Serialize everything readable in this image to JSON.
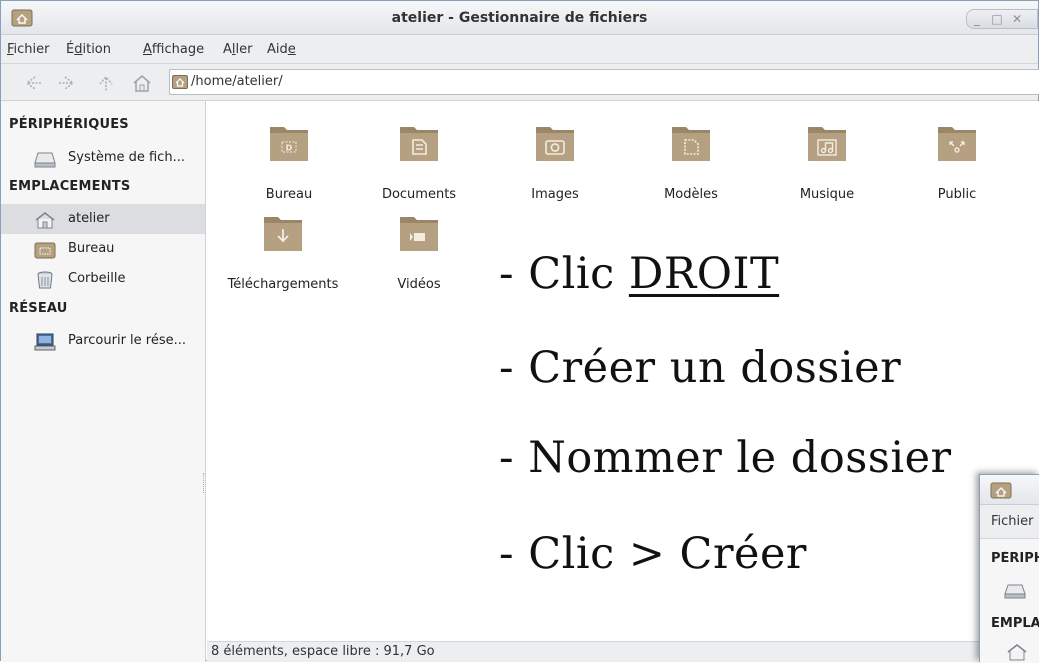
{
  "window": {
    "title": "atelier - Gestionnaire de fichiers",
    "controls": [
      "_",
      "□",
      "✕"
    ]
  },
  "menu": [
    {
      "pre": "",
      "ul": "F",
      "post": "ichier"
    },
    {
      "pre": "É",
      "ul": "d",
      "post": "ition"
    },
    {
      "pre": "",
      "ul": "A",
      "post": "ffichage"
    },
    {
      "pre": "A",
      "ul": "l",
      "post": "ler"
    },
    {
      "pre": "Aid",
      "ul": "e",
      "post": ""
    }
  ],
  "toolbar": {
    "path": "/home/atelier/"
  },
  "sidebar": {
    "sections": {
      "devices": "PÉRIPHÉRIQUES",
      "places": "EMPLACEMENTS",
      "network": "RÉSEAU"
    },
    "devices": [
      {
        "label": "Système de fich...",
        "icon": "drive-icon"
      }
    ],
    "places": [
      {
        "label": "atelier",
        "icon": "home-icon"
      },
      {
        "label": "Bureau",
        "icon": "desktop-folder-icon"
      },
      {
        "label": "Corbeille",
        "icon": "trash-icon"
      }
    ],
    "network": [
      {
        "label": "Parcourir le rése...",
        "icon": "network-icon"
      }
    ]
  },
  "files": [
    {
      "name": "Bureau",
      "emblem": "D"
    },
    {
      "name": "Documents",
      "emblem": "doc"
    },
    {
      "name": "Images",
      "emblem": "camera"
    },
    {
      "name": "Modèles",
      "emblem": "template"
    },
    {
      "name": "Musique",
      "emblem": "music"
    },
    {
      "name": "Public",
      "emblem": "share"
    },
    {
      "name": "Téléchargements",
      "emblem": "download"
    },
    {
      "name": "Vidéos",
      "emblem": "video"
    }
  ],
  "status": "8 éléments, espace libre : 91,7 Go",
  "instructions": {
    "line1_prefix": "- Clic ",
    "line1_underlined": "DROIT",
    "line2": "- Créer un dossier",
    "line3": "- Nommer le dossier",
    "line4": "- Clic > Créer"
  },
  "overlay_window": {
    "menu_text": "Fichier",
    "section1": "PÉRIPHÉRIQUES",
    "section2": "EMPLACEMENTS"
  },
  "colors": {
    "folder": "#b5a182",
    "folder_dark": "#9b8768",
    "selection": "#dcdde0"
  }
}
